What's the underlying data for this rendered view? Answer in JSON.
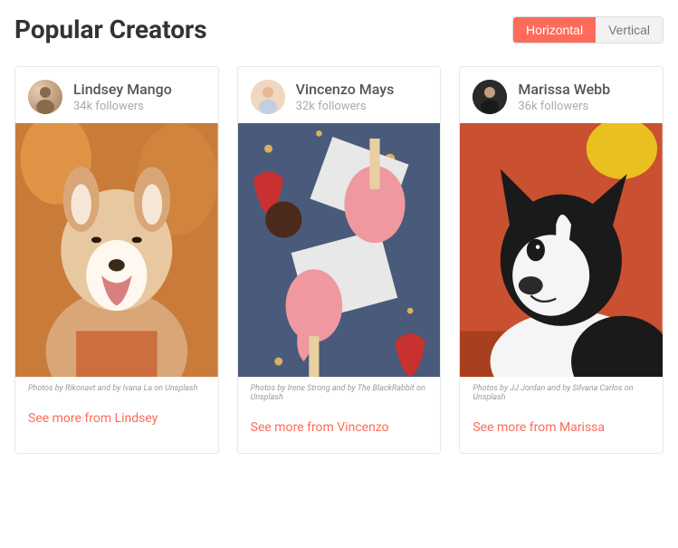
{
  "header": {
    "title": "Popular Creators",
    "toggle": {
      "horizontal": "Horizontal",
      "vertical": "Vertical"
    }
  },
  "creators": [
    {
      "name": "Lindsey Mango",
      "followers": "34k followers",
      "credit": "Photos by Rikonavt and by Ivana La on Unsplash",
      "see_more": "See more from Lindsey"
    },
    {
      "name": "Vincenzo Mays",
      "followers": "32k followers",
      "credit": "Photos by Irene Strong and by The BlackRabbit on Unsplash",
      "see_more": "See more from Vincenzo"
    },
    {
      "name": "Marissa Webb",
      "followers": "36k followers",
      "credit": "Photos by JJ Jordan and by Silvana Carlos on Unsplash",
      "see_more": "See more from Marissa"
    }
  ]
}
